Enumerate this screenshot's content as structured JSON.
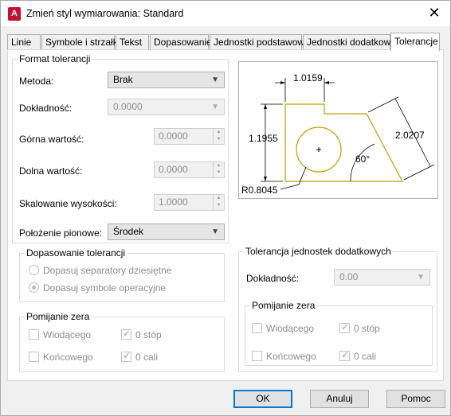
{
  "window": {
    "title": "Zmień styl wymiarowania: Standard",
    "app_icon_letter": "A",
    "close_glyph": "✕"
  },
  "tabs": [
    {
      "label": "Linie"
    },
    {
      "label": "Symbole i strzałki"
    },
    {
      "label": "Tekst"
    },
    {
      "label": "Dopasowanie"
    },
    {
      "label": "Jednostki podstawowe"
    },
    {
      "label": "Jednostki dodatkowe"
    },
    {
      "label": "Tolerancje",
      "active": true
    }
  ],
  "format": {
    "group_label": "Format tolerancji",
    "method_label": "Metoda:",
    "method_value": "Brak",
    "precision_label": "Dokładność:",
    "precision_value": "0.0000",
    "upper_label": "Górna wartość:",
    "upper_value": "0.0000",
    "lower_label": "Dolna wartość:",
    "lower_value": "0.0000",
    "scale_label": "Skalowanie wysokości:",
    "scale_value": "1.0000",
    "vpos_label": "Położenie pionowe:",
    "vpos_value": "Środek"
  },
  "alignment": {
    "group_label": "Dopasowanie tolerancji",
    "option1": "Dopasuj separatory dziesiętne",
    "option2": "Dopasuj symbole operacyjne"
  },
  "zero_left": {
    "group_label": "Pomijanie zera",
    "leading": "Wiodącego",
    "trailing": "Końcowego",
    "feet": "0 stóp",
    "inches": "0 cali"
  },
  "alt_units": {
    "group_label": "Tolerancja jednostek dodatkowych",
    "precision_label": "Dokładność:",
    "precision_value": "0.00"
  },
  "zero_right": {
    "group_label": "Pomijanie zera",
    "leading": "Wiodącego",
    "trailing": "Końcowego",
    "feet": "0 stóp",
    "inches": "0 cali"
  },
  "preview": {
    "dim_top": "1.0159",
    "dim_left": "1.1955",
    "dim_right": "2.0207",
    "angle": "60°",
    "radius": "R0.8045"
  },
  "buttons": {
    "ok": "OK",
    "cancel": "Anuluj",
    "help": "Pomoc"
  },
  "colors": {
    "accent": "#0078d7",
    "preview_part": "#b8a000",
    "app_icon": "#c8102e"
  }
}
